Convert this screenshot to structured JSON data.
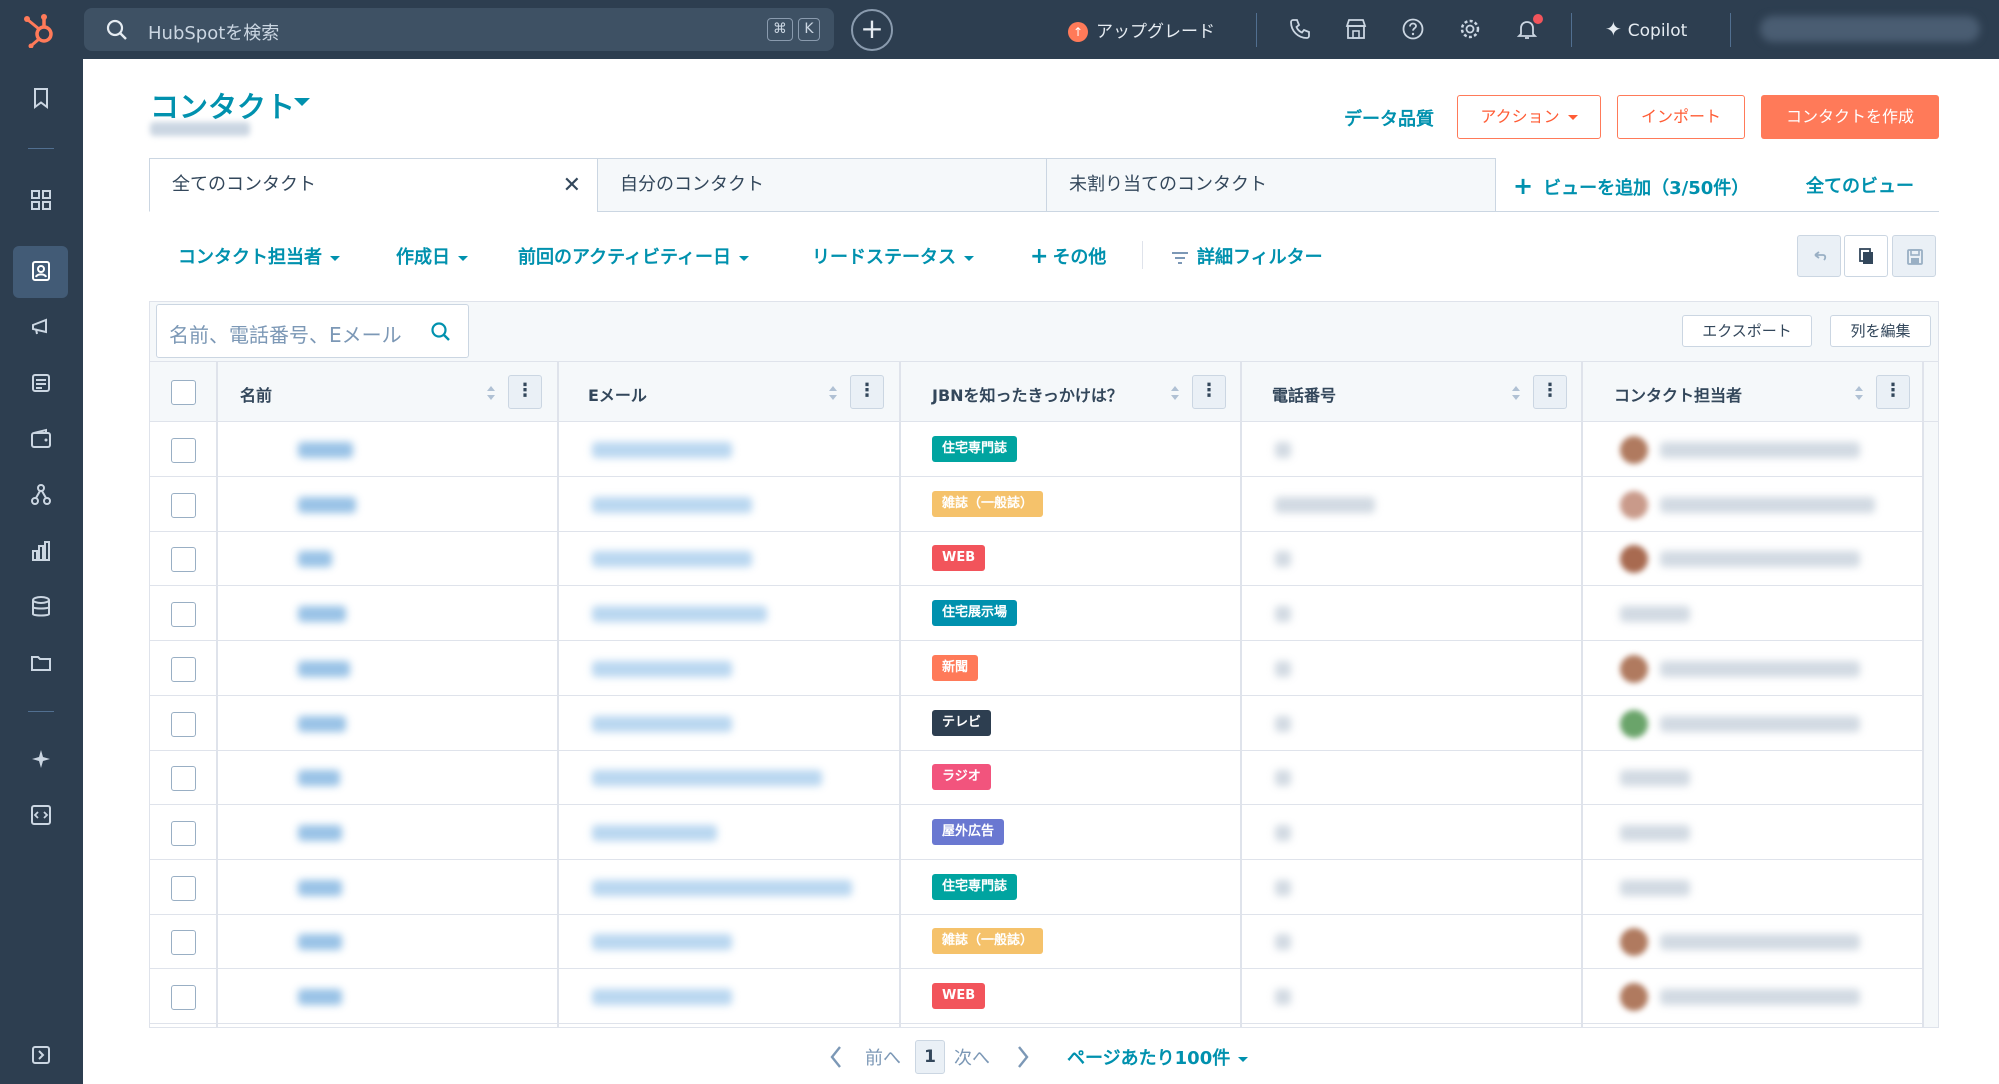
{
  "topbar": {
    "search_placeholder": "HubSpotを検索",
    "kbd_cmd": "⌘",
    "kbd_k": "K",
    "upgrade_label": "アップグレード",
    "copilot_label": "Copilot"
  },
  "header": {
    "title": "コンタクト",
    "data_quality": "データ品質",
    "actions_label": "アクション",
    "import_label": "インポート",
    "create_label": "コンタクトを作成"
  },
  "tabs": {
    "items": [
      "全てのコンタクト",
      "自分のコンタクト",
      "未割り当てのコンタクト"
    ],
    "add_view": "ビューを追加（3/50件）",
    "all_views": "全てのビュー"
  },
  "filters": {
    "owner": "コンタクト担当者",
    "created": "作成日",
    "last_activity": "前回のアクティビティー日",
    "lead_status": "リードステータス",
    "more": "その他",
    "advanced": "詳細フィルター"
  },
  "table": {
    "search_placeholder": "名前、電話番号、Eメール",
    "export_label": "エクスポート",
    "edit_columns_label": "列を編集",
    "columns": [
      "名前",
      "Eメール",
      "JBNを知ったきっかけは？",
      "電話番号",
      "コンタクト担当者"
    ],
    "rows": [
      {
        "source": "住宅専門誌",
        "color": "#00a4a0"
      },
      {
        "source": "雑誌（一般誌）",
        "color": "#f5c26b"
      },
      {
        "source": "WEB",
        "color": "#f2545b"
      },
      {
        "source": "住宅展示場",
        "color": "#0091ae"
      },
      {
        "source": "新聞",
        "color": "#ff7a59"
      },
      {
        "source": "テレビ",
        "color": "#2d3e50"
      },
      {
        "source": "ラジオ",
        "color": "#f2547d"
      },
      {
        "source": "屋外広告",
        "color": "#6a78d1"
      },
      {
        "source": "住宅専門誌",
        "color": "#00a4a0"
      },
      {
        "source": "雑誌（一般誌）",
        "color": "#f5c26b"
      },
      {
        "source": "WEB",
        "color": "#f2545b"
      }
    ]
  },
  "pagination": {
    "prev": "前へ",
    "page": "1",
    "next": "次へ",
    "per_page": "ページあたり100件"
  },
  "colors": {
    "accent": "#0091ae",
    "brand": "#ff7a59",
    "nav": "#2d3e50"
  }
}
